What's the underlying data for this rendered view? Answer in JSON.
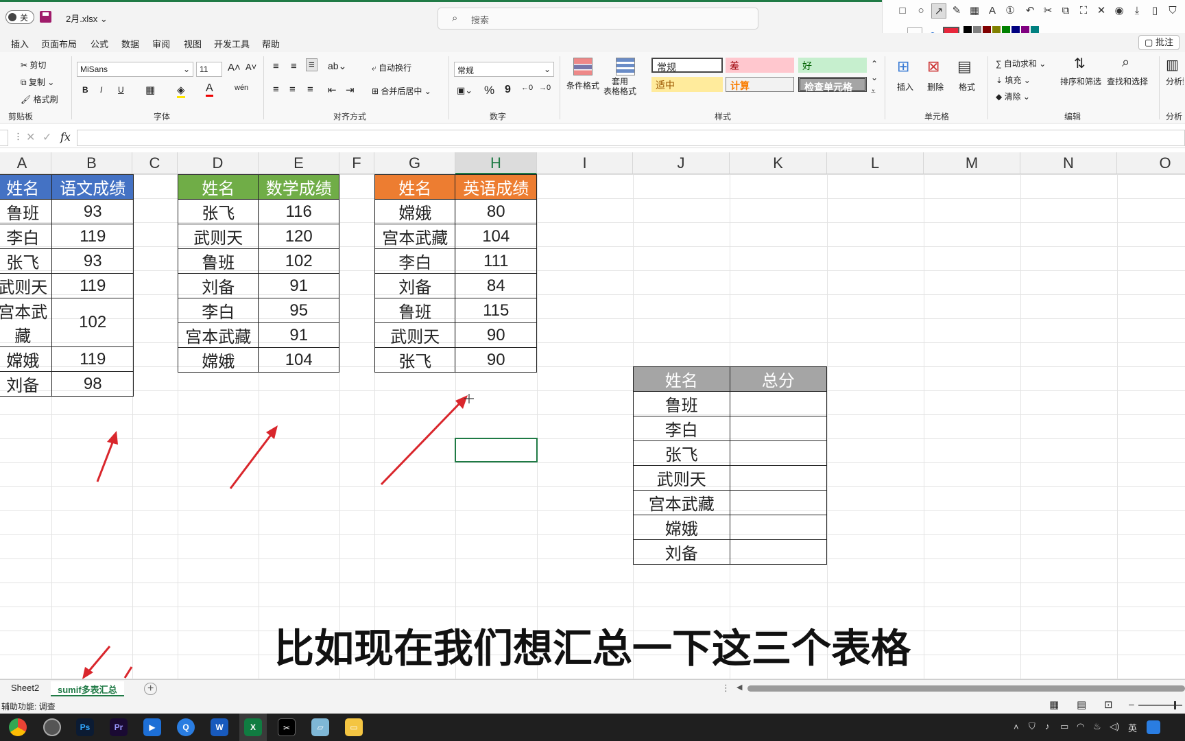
{
  "titlebar": {
    "toggle_label": "关",
    "filename": "2月.xlsx ⌄",
    "search_placeholder": "搜索"
  },
  "menu": [
    "插入",
    "页面布局",
    "公式",
    "数据",
    "审阅",
    "视图",
    "开发工具",
    "帮助"
  ],
  "note_button": "▢ 批注",
  "ribbon": {
    "clipboard": {
      "cut": "剪切",
      "copy": "复制 ⌄",
      "format_painter": "格式刷",
      "label": "剪贴板"
    },
    "font": {
      "name": "MiSans",
      "size": "11",
      "label": "字体",
      "bold": "B",
      "italic": "I",
      "underline": "U"
    },
    "align": {
      "wrap": "自动换行",
      "merge": "合并后居中 ⌄",
      "label": "对齐方式"
    },
    "number": {
      "format": "常规",
      "label": "数字",
      "percent": "%",
      "comma": "9"
    },
    "styles": {
      "conditional": "条件格式",
      "table_format": "套用\n表格格式",
      "label": "样式",
      "cells": [
        "常规",
        "差",
        "好",
        "适中",
        "计算",
        "检查单元格"
      ]
    },
    "cells": {
      "insert": "插入",
      "delete": "删除",
      "format": "格式",
      "label": "单元格"
    },
    "edit": {
      "autosum": "∑ 自动求和 ⌄",
      "fill": "填充 ⌄",
      "clear": "清除 ⌄",
      "sort": "排序和筛选",
      "find": "查找和选择",
      "label": "编辑"
    },
    "analysis": {
      "btn": "分析数据",
      "label": "分析"
    }
  },
  "formula_bar": {
    "fx": "fx",
    "cancel": "✕",
    "confirm": "✓"
  },
  "columns": [
    "A",
    "B",
    "C",
    "D",
    "E",
    "F",
    "G",
    "H",
    "I",
    "J",
    "K",
    "L",
    "M",
    "N",
    "O"
  ],
  "table_chinese": {
    "headers": [
      "姓名",
      "语文成绩"
    ],
    "color": "#4472c4",
    "rows": [
      [
        "鲁班",
        "93"
      ],
      [
        "李白",
        "119"
      ],
      [
        "张飞",
        "93"
      ],
      [
        "武则天",
        "119"
      ],
      [
        "宫本武藏",
        "102"
      ],
      [
        "嫦娥",
        "119"
      ],
      [
        "刘备",
        "98"
      ]
    ]
  },
  "table_math": {
    "headers": [
      "姓名",
      "数学成绩"
    ],
    "color": "#70ad47",
    "rows": [
      [
        "张飞",
        "116"
      ],
      [
        "武则天",
        "120"
      ],
      [
        "鲁班",
        "102"
      ],
      [
        "刘备",
        "91"
      ],
      [
        "李白",
        "95"
      ],
      [
        "宫本武藏",
        "91"
      ],
      [
        "嫦娥",
        "104"
      ]
    ]
  },
  "table_english": {
    "headers": [
      "姓名",
      "英语成绩"
    ],
    "color": "#ed7d31",
    "rows": [
      [
        "嫦娥",
        "80"
      ],
      [
        "宫本武藏",
        "104"
      ],
      [
        "李白",
        "111"
      ],
      [
        "刘备",
        "84"
      ],
      [
        "鲁班",
        "115"
      ],
      [
        "武则天",
        "90"
      ],
      [
        "张飞",
        "90"
      ]
    ]
  },
  "table_total": {
    "headers": [
      "姓名",
      "总分"
    ],
    "color": "#a5a5a5",
    "rows": [
      [
        "鲁班",
        ""
      ],
      [
        "李白",
        ""
      ],
      [
        "张飞",
        ""
      ],
      [
        "武则天",
        ""
      ],
      [
        "宫本武藏",
        ""
      ],
      [
        "嫦娥",
        ""
      ],
      [
        "刘备",
        ""
      ]
    ]
  },
  "subtitle": "比如现在我们想汇总一下这三个表格",
  "sheets": {
    "tab1": "Sheet2",
    "tab2": "sumif多表汇总",
    "add": "+"
  },
  "status": {
    "accessibility": "辅助功能: 调查"
  },
  "accent": "#1f7a45",
  "arrow_color": "#d9262c",
  "taskbar": {
    "ps": "Ps",
    "pr": "Pr",
    "word": "W",
    "excel": "X",
    "ime": "英"
  }
}
